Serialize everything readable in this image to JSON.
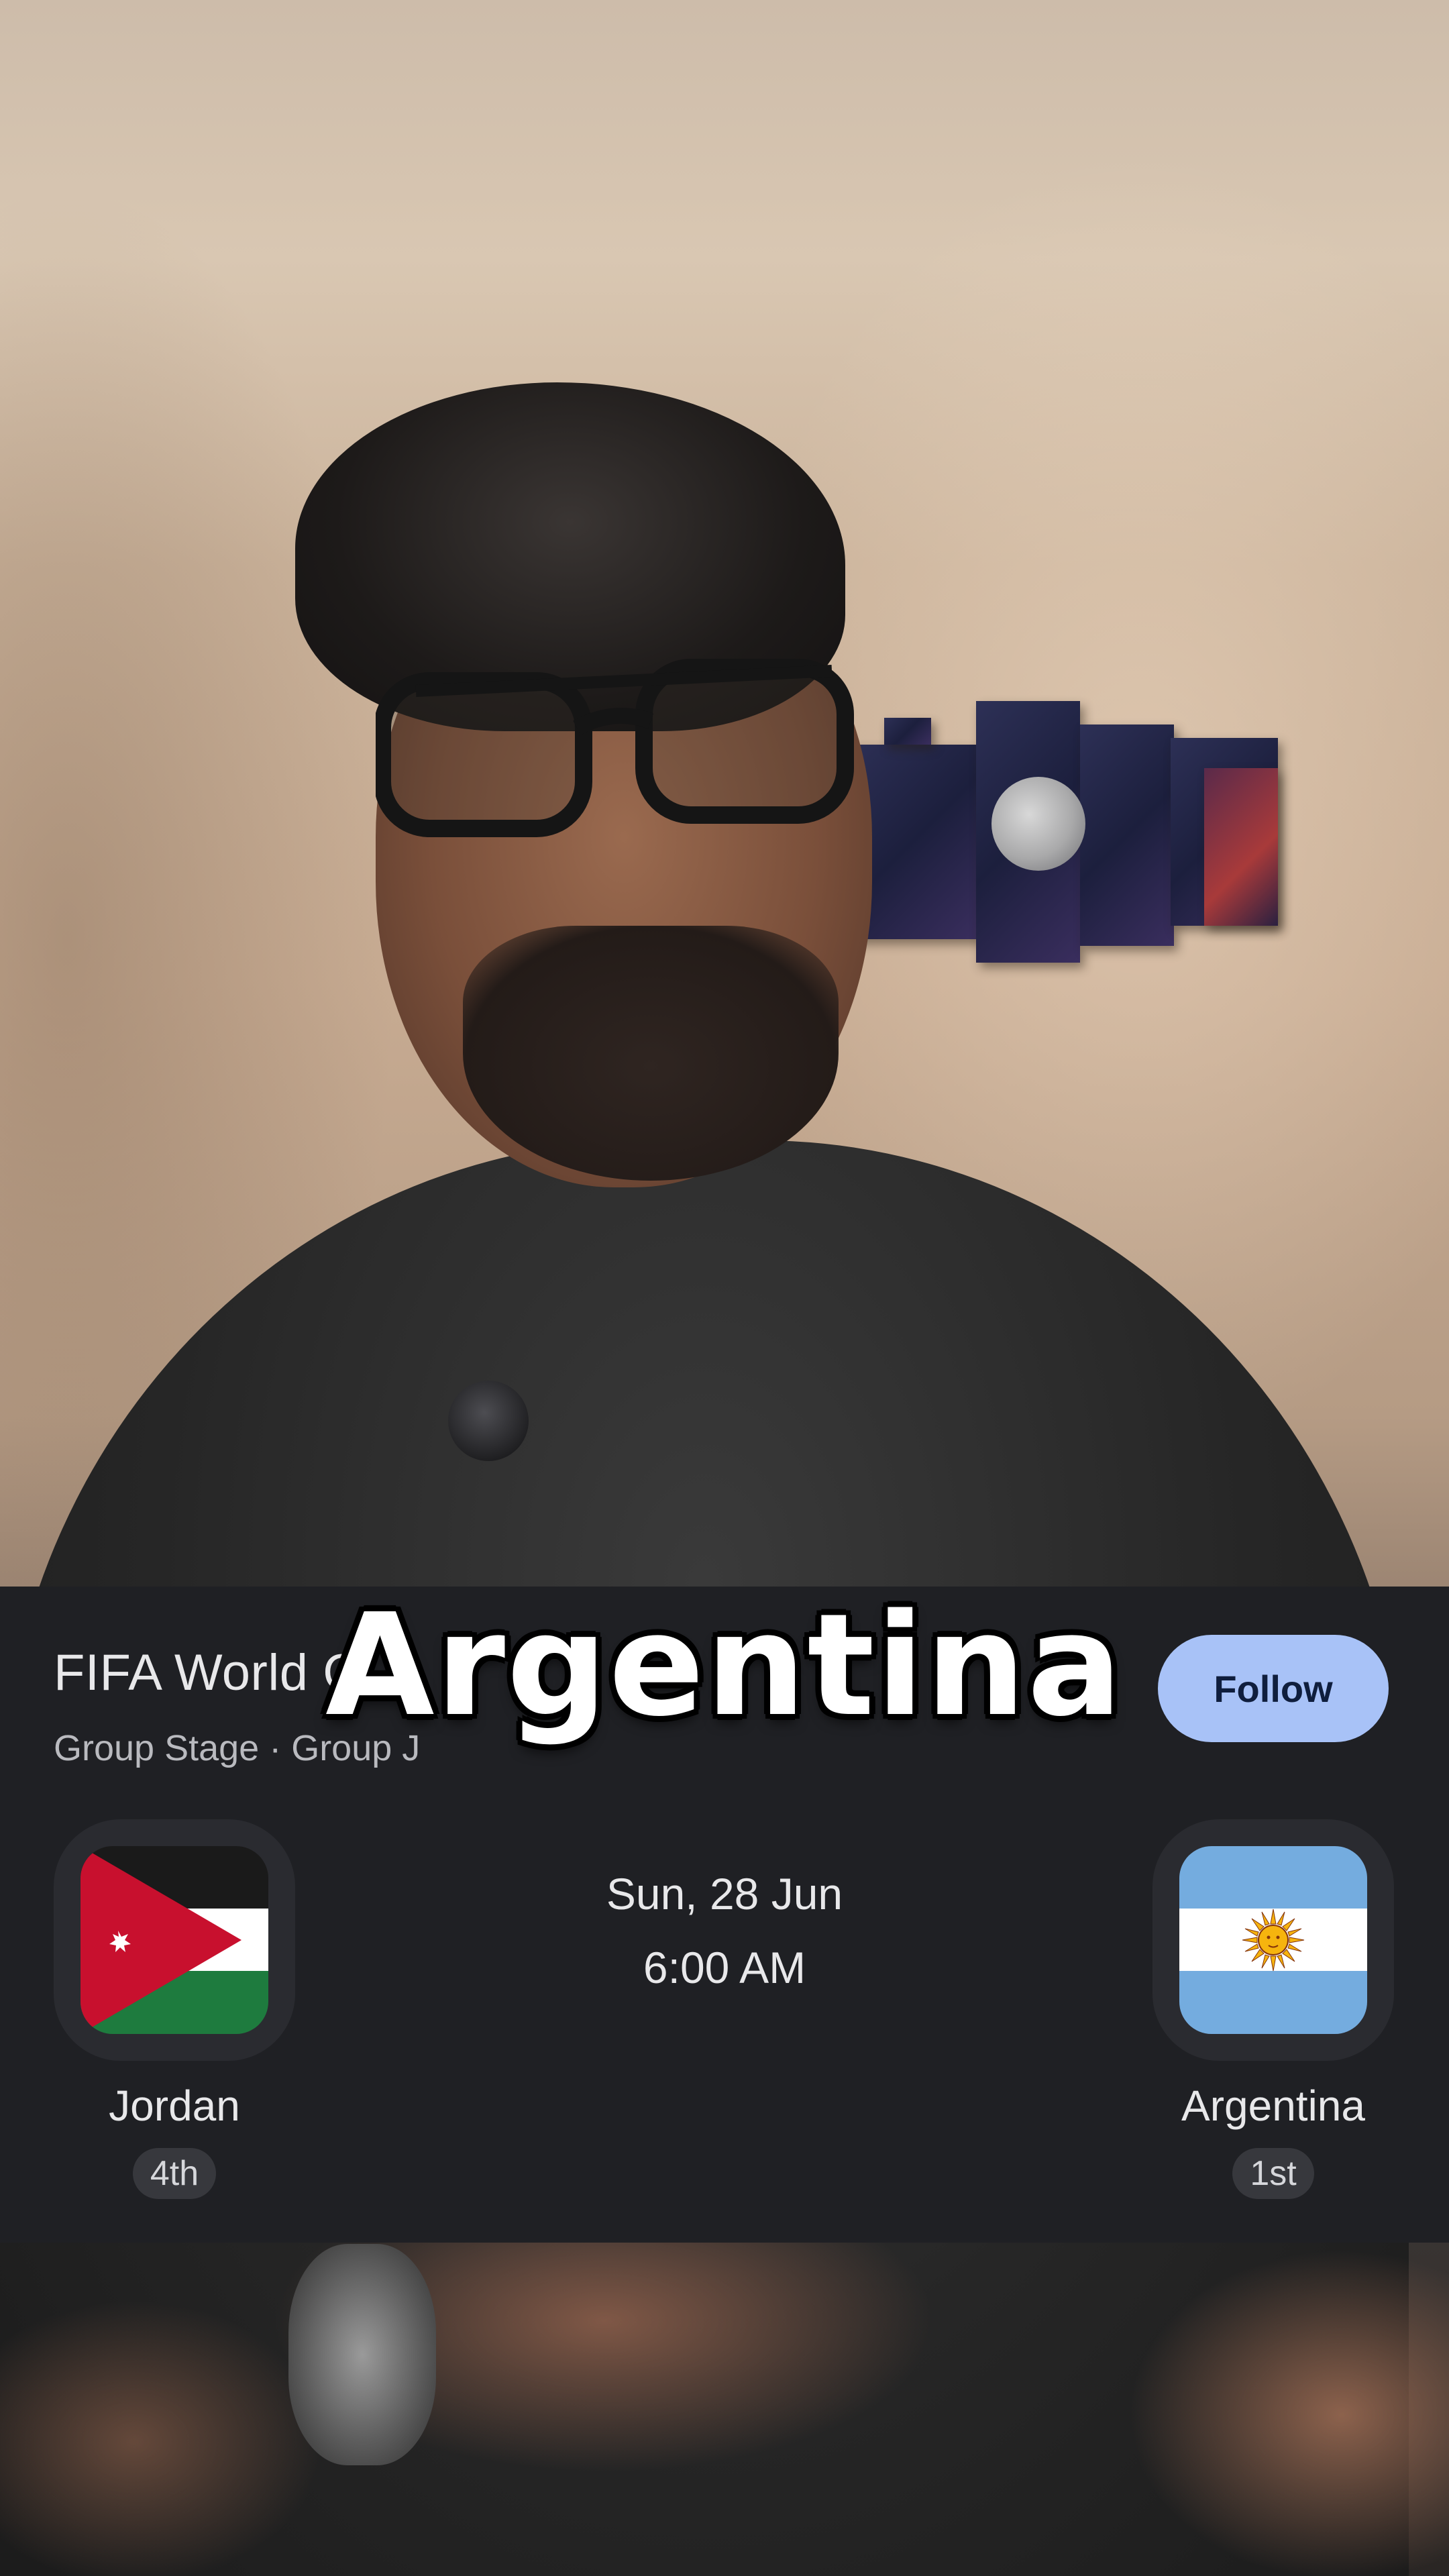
{
  "video": {
    "caption": "Argentina"
  },
  "match_card": {
    "competition_title": "FIFA World C",
    "stage": "Group Stage · Group J",
    "follow_label": "Follow",
    "home_team": {
      "name": "Jordan",
      "rank": "4th",
      "flag": "jordan-flag-icon"
    },
    "away_team": {
      "name": "Argentina",
      "rank": "1st",
      "flag": "argentina-flag-icon"
    },
    "date": "Sun, 28 Jun",
    "time": "6:00 AM"
  },
  "colors": {
    "card_background": "#1f2024",
    "follow_button": "#a8c2f7",
    "rank_pill": "#37383d",
    "caption_text": "#ffffff",
    "caption_outline": "#000000"
  }
}
